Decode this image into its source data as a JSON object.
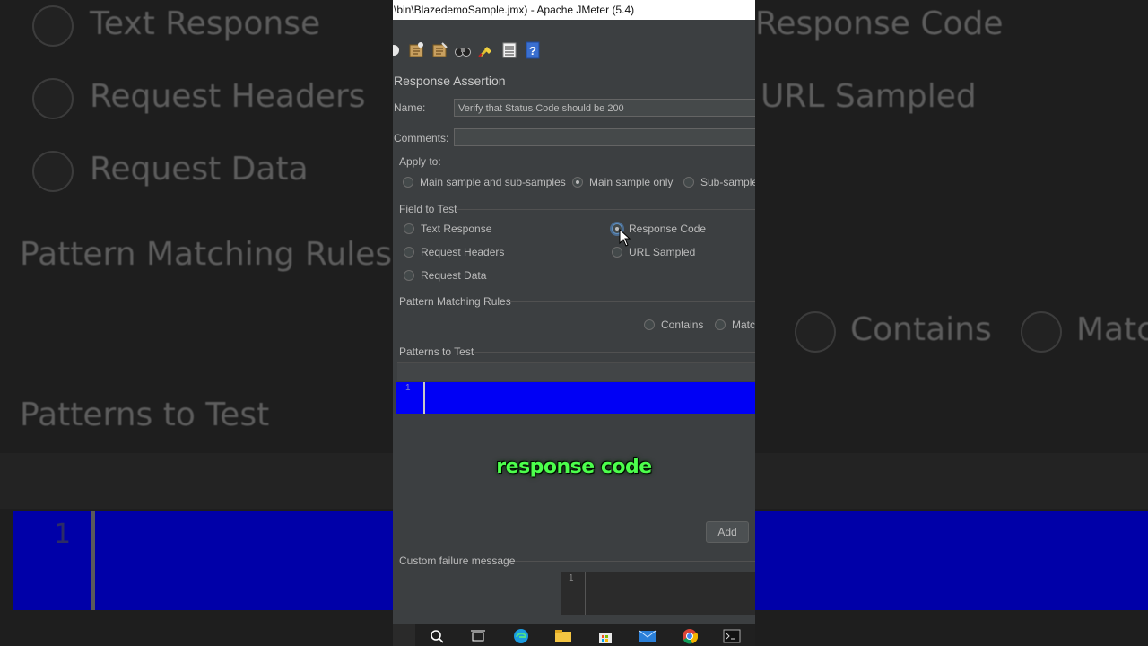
{
  "window_title": "\\bin\\BlazedemoSample.jmx) - Apache JMeter (5.4)",
  "panel_title": "Response Assertion",
  "name_label": "Name:",
  "name_value": "Verify that Status Code should be 200",
  "comments_label": "Comments:",
  "comments_value": "",
  "apply_to": {
    "label": "Apply to:",
    "options": [
      "Main sample and sub-samples",
      "Main sample only",
      "Sub-sample"
    ],
    "selected": "Main sample only"
  },
  "field_to_test": {
    "label": "Field to Test",
    "options": [
      "Text Response",
      "Request Headers",
      "Request Data",
      "Response Code",
      "URL Sampled"
    ],
    "selected": "Response Code"
  },
  "pattern_matching": {
    "label": "Pattern Matching Rules",
    "options": [
      "Contains",
      "Matc"
    ]
  },
  "patterns_to_test": {
    "label": "Patterns to Test",
    "line_number": "1"
  },
  "add_button": "Add",
  "custom_failure": {
    "label": "Custom failure message",
    "line_number": "1"
  },
  "caption": "response code",
  "background_zoom": {
    "texts": [
      "Text Response",
      "Request Headers",
      "Request Data",
      "Pattern Matching Rules",
      "Patterns to Test",
      "Response Code",
      "URL Sampled",
      "Contains",
      "Matc"
    ],
    "line_number": "1"
  },
  "colors": {
    "editor_bg": "#0000f5",
    "caption_green": "#4cff4c",
    "window_bg": "#3c3f41"
  },
  "toolbar_icons": [
    "circle-icon",
    "templates-icon",
    "clear-icon",
    "binoculars-icon",
    "broom-icon",
    "list-icon",
    "help-icon"
  ],
  "taskbar_icons": [
    "search-icon",
    "task-view-icon",
    "edge-icon",
    "file-explorer-icon",
    "store-icon",
    "mail-icon",
    "chrome-icon",
    "terminal-icon"
  ]
}
